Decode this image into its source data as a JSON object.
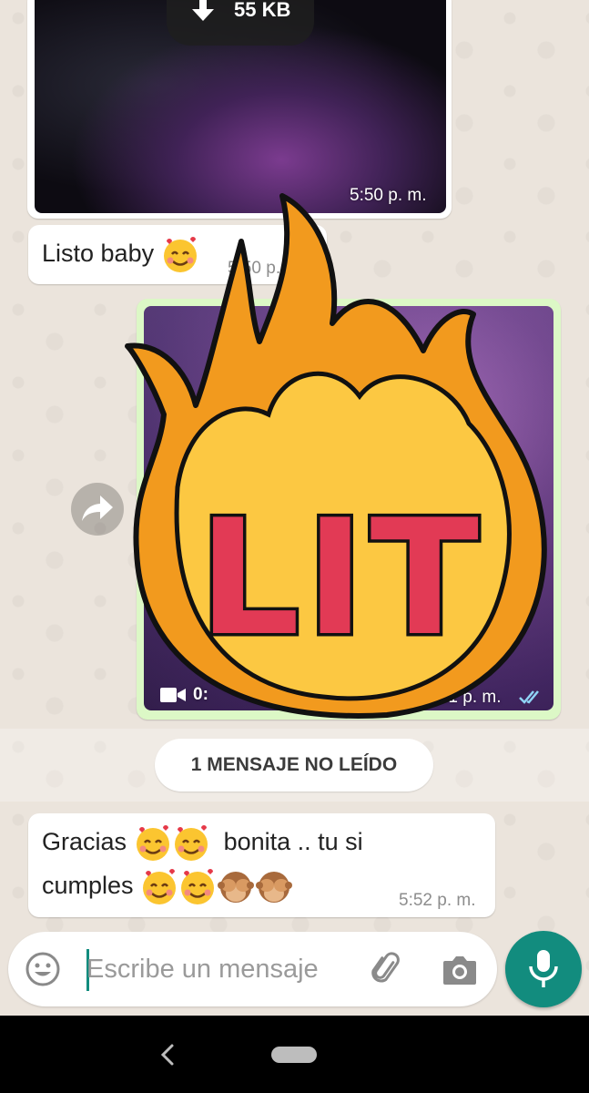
{
  "messages": {
    "top_media": {
      "size": "55 KB",
      "time": "5:50 p. m."
    },
    "listo": {
      "text": "Listo baby",
      "time": "5:50 p. m."
    },
    "video_out": {
      "duration": "0:",
      "time": "5:51 p. m."
    },
    "gracias": {
      "line1": "Gracias",
      "line1b": "bonita .. tu si",
      "line2": "cumples",
      "time": "5:52 p. m."
    }
  },
  "unread": {
    "label": "1 MENSAJE NO LEÍDO"
  },
  "sticker": {
    "text": "LIT"
  },
  "composer": {
    "placeholder": "Escribe un mensaje",
    "value": ""
  },
  "icons": {
    "download": "download-arrow-icon",
    "forward": "forward-icon",
    "video": "video-camera-icon",
    "ticks": "double-check-icon",
    "emoji": "smiley-icon",
    "attach": "paperclip-icon",
    "camera": "camera-icon",
    "mic": "microphone-icon",
    "back": "back-chevron-icon",
    "home": "home-pill-icon"
  },
  "colors": {
    "accent": "#128c7e",
    "outgoing": "#dcf8c6",
    "read_ticks": "#4fc3f7"
  }
}
